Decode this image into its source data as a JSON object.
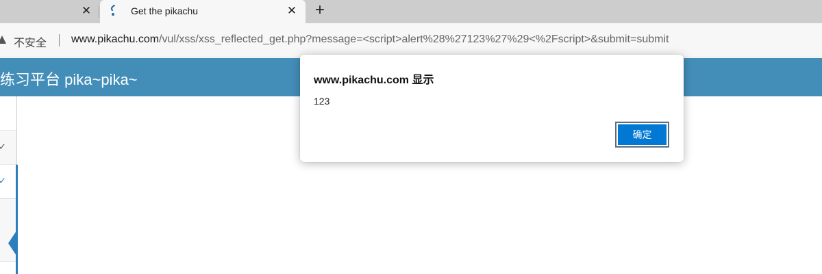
{
  "tabs": {
    "previous": {
      "close_glyph": "✕"
    },
    "active": {
      "title": "Get the pikachu",
      "favicon": "pikachu-favicon",
      "close_glyph": "✕"
    },
    "new_tab_glyph": "+"
  },
  "address_bar": {
    "security_icon": "warning-triangle-icon",
    "security_label": "不安全",
    "url_host": "www.pikachu.com",
    "url_path": "/vul/xss/xss_reflected_get.php?message=<script>alert%28%27123%27%29<%2Fscript>&submit=submit"
  },
  "page": {
    "brand": "练习平台 pika~pika~",
    "header_color": "#438eb9",
    "sidebar": {
      "check_glyph": "✓",
      "accent_color": "#2b7dbc"
    }
  },
  "alert_dialog": {
    "title": "www.pikachu.com 显示",
    "message": "123",
    "ok_label": "确定",
    "button_color": "#0078d4"
  }
}
